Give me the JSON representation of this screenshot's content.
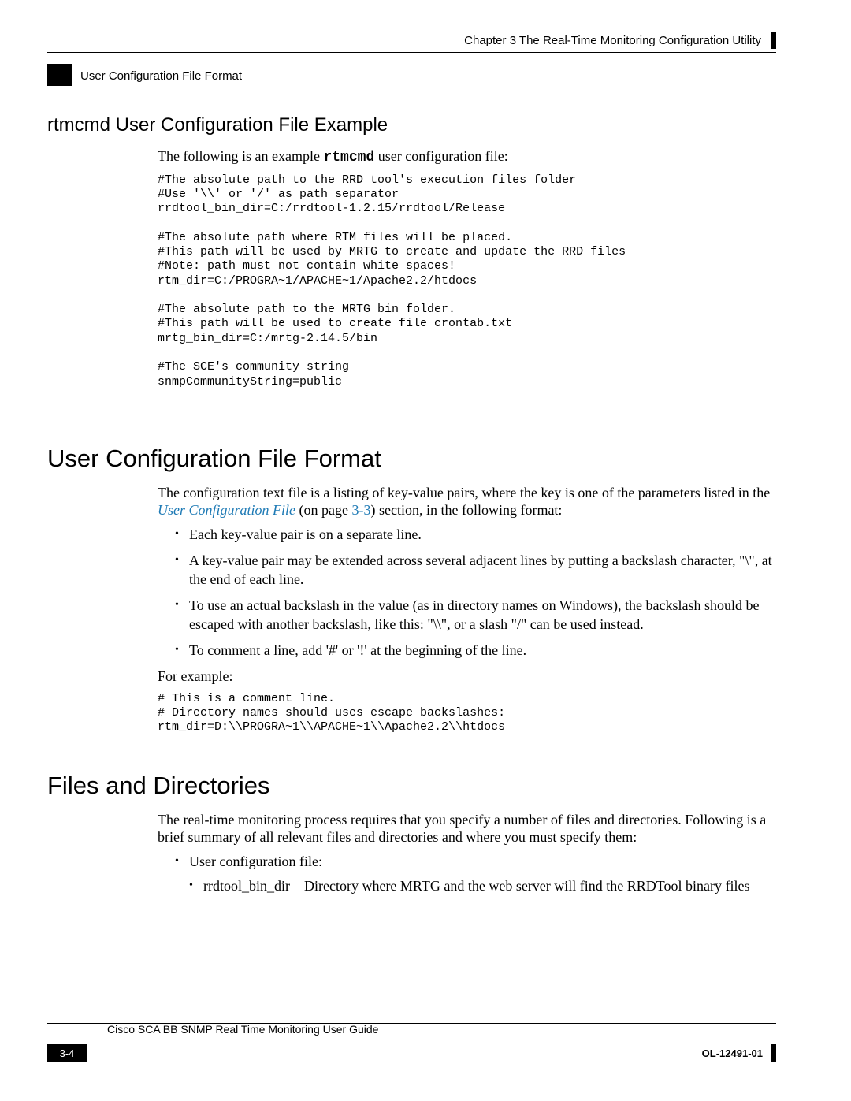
{
  "header": {
    "chapter": "Chapter 3      The Real-Time Monitoring Configuration Utility",
    "section": "User Configuration File Format"
  },
  "section_h2": "rtmcmd User Configuration File Example",
  "intro_text_pre": "The following is an example ",
  "intro_text_code": "rtmcmd",
  "intro_text_post": " user configuration file:",
  "code_block1": "#The absolute path to the RRD tool's execution files folder\n#Use '\\\\' or '/' as path separator\nrrdtool_bin_dir=C:/rrdtool-1.2.15/rrdtool/Release\n\n#The absolute path where RTM files will be placed.\n#This path will be used by MRTG to create and update the RRD files\n#Note: path must not contain white spaces!\nrtm_dir=C:/PROGRA~1/APACHE~1/Apache2.2/htdocs\n\n#The absolute path to the MRTG bin folder.\n#This path will be used to create file crontab.txt\nmrtg_bin_dir=C:/mrtg-2.14.5/bin\n\n#The SCE's community string\nsnmpCommunityString=public",
  "h1_ucff": "User Configuration File Format",
  "ucff_para_pre": "The configuration text file is a listing of key-value pairs, where the key is one of the parameters listed in the ",
  "ucff_link": "User Configuration File",
  "ucff_para_mid": " (on page ",
  "ucff_pageref": "3-3",
  "ucff_para_post": ") section, in the following format:",
  "bullets1": [
    "Each key-value pair is on a separate line.",
    "A key-value pair may be extended across several adjacent lines by putting a backslash character, \"\\\", at the end of each line.",
    "To use an actual backslash in the value (as in directory names on Windows), the backslash should be escaped with another backslash, like this: \"\\\\\", or a slash \"/\" can be used instead.",
    "To comment a line, add '#' or '!' at the beginning of the line."
  ],
  "for_example": "For example:",
  "code_block2": "# This is a comment line.\n# Directory names should uses escape backslashes:\nrtm_dir=D:\\\\PROGRA~1\\\\APACHE~1\\\\Apache2.2\\\\htdocs",
  "h1_files": "Files and Directories",
  "files_para": "The real-time monitoring process requires that you specify a number of files and directories. Following is a brief summary of all relevant files and directories and where you must specify them:",
  "files_bullet1": "User configuration file:",
  "files_sub1": "rrdtool_bin_dir—Directory where MRTG and the web server will find the RRDTool binary files",
  "footer": {
    "title": "Cisco SCA BB SNMP Real Time Monitoring User Guide",
    "page": "3-4",
    "docid": "OL-12491-01"
  }
}
